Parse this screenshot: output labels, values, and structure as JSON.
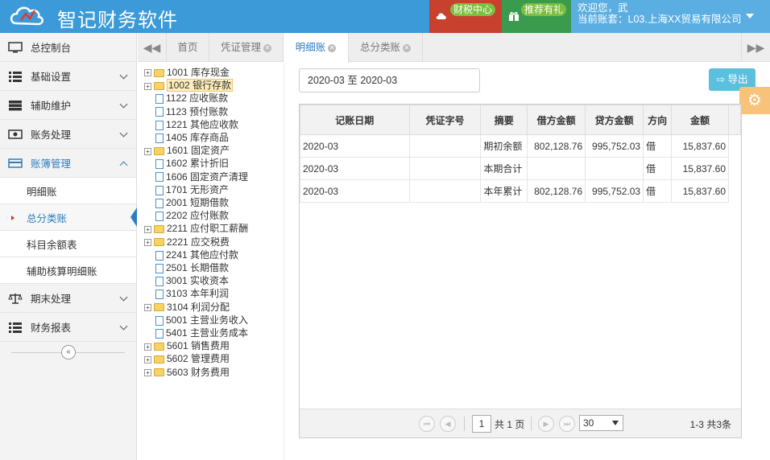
{
  "app": {
    "title": "智记财务软件"
  },
  "header": {
    "tax_center": "财税中心",
    "recommend": "推荐有礼",
    "welcome": "欢迎您，武",
    "account_set": "当前账套：L03.上海XX贸易有限公司"
  },
  "sidebar": {
    "items": [
      {
        "label": "总控制台",
        "icon": "monitor-icon"
      },
      {
        "label": "基础设置",
        "icon": "list-icon"
      },
      {
        "label": "辅助维护",
        "icon": "server-icon"
      },
      {
        "label": "账务处理",
        "icon": "money-icon"
      },
      {
        "label": "账簿管理",
        "icon": "card-icon"
      }
    ],
    "subitems": [
      "明细账",
      "总分类账",
      "科目余额表",
      "辅助核算明细账"
    ],
    "items_after": [
      {
        "label": "期末处理",
        "icon": "scale-icon"
      },
      {
        "label": "财务报表",
        "icon": "list-icon"
      }
    ],
    "collapse_glyph": "«"
  },
  "tabs": [
    {
      "label": "首页",
      "closable": false
    },
    {
      "label": "凭证管理",
      "closable": true
    },
    {
      "label": "明细账",
      "closable": true,
      "active": true
    },
    {
      "label": "总分类账",
      "closable": true
    }
  ],
  "tab_nav": {
    "prev": "◀◀",
    "next": "▶▶"
  },
  "tree": [
    {
      "label": "1001 库存现金",
      "type": "folder",
      "expandable": true
    },
    {
      "label": "1002 银行存款",
      "type": "folder",
      "expandable": true,
      "selected": true
    },
    {
      "label": "1122 应收账款",
      "type": "file"
    },
    {
      "label": "1123 预付账款",
      "type": "file"
    },
    {
      "label": "1221 其他应收款",
      "type": "file"
    },
    {
      "label": "1405 库存商品",
      "type": "file"
    },
    {
      "label": "1601 固定资产",
      "type": "folder",
      "expandable": true
    },
    {
      "label": "1602 累计折旧",
      "type": "file"
    },
    {
      "label": "1606 固定资产清理",
      "type": "file"
    },
    {
      "label": "1701 无形资产",
      "type": "file"
    },
    {
      "label": "2001 短期借款",
      "type": "file"
    },
    {
      "label": "2202 应付账款",
      "type": "file"
    },
    {
      "label": "2211 应付职工薪酬",
      "type": "folder",
      "expandable": true
    },
    {
      "label": "2221 应交税费",
      "type": "folder",
      "expandable": true
    },
    {
      "label": "2241 其他应付款",
      "type": "file"
    },
    {
      "label": "2501 长期借款",
      "type": "file"
    },
    {
      "label": "3001 实收资本",
      "type": "file"
    },
    {
      "label": "3103 本年利润",
      "type": "file"
    },
    {
      "label": "3104 利润分配",
      "type": "folder",
      "expandable": true
    },
    {
      "label": "5001 主营业务收入",
      "type": "file"
    },
    {
      "label": "5401 主营业务成本",
      "type": "file"
    },
    {
      "label": "5601 销售费用",
      "type": "folder",
      "expandable": true
    },
    {
      "label": "5602 管理费用",
      "type": "folder",
      "expandable": true
    },
    {
      "label": "5603 财务费用",
      "type": "folder",
      "expandable": true
    }
  ],
  "toolbar": {
    "date_range": "2020-03 至 2020-03",
    "export_label": "导出"
  },
  "table": {
    "columns": [
      "记账日期",
      "凭证字号",
      "摘要",
      "借方金额",
      "贷方金额",
      "方向",
      "金额"
    ],
    "rows": [
      [
        "2020-03",
        "",
        "期初余额",
        "802,128.76",
        "995,752.03",
        "借",
        "15,837.60"
      ],
      [
        "2020-03",
        "",
        "本期合计",
        "",
        "",
        "借",
        "15,837.60"
      ],
      [
        "2020-03",
        "",
        "本年累计",
        "802,128.76",
        "995,752.03",
        "借",
        "15,837.60"
      ]
    ]
  },
  "pager": {
    "page": "1",
    "total_pages": "共 1 页",
    "page_size": "30",
    "info": "1-3 共3条"
  },
  "colors": {
    "header_bg": "#3c9ad8",
    "accent": "#2d7ec1",
    "tax_btn": "#c8402e",
    "gift_btn": "#3a9a4e"
  }
}
